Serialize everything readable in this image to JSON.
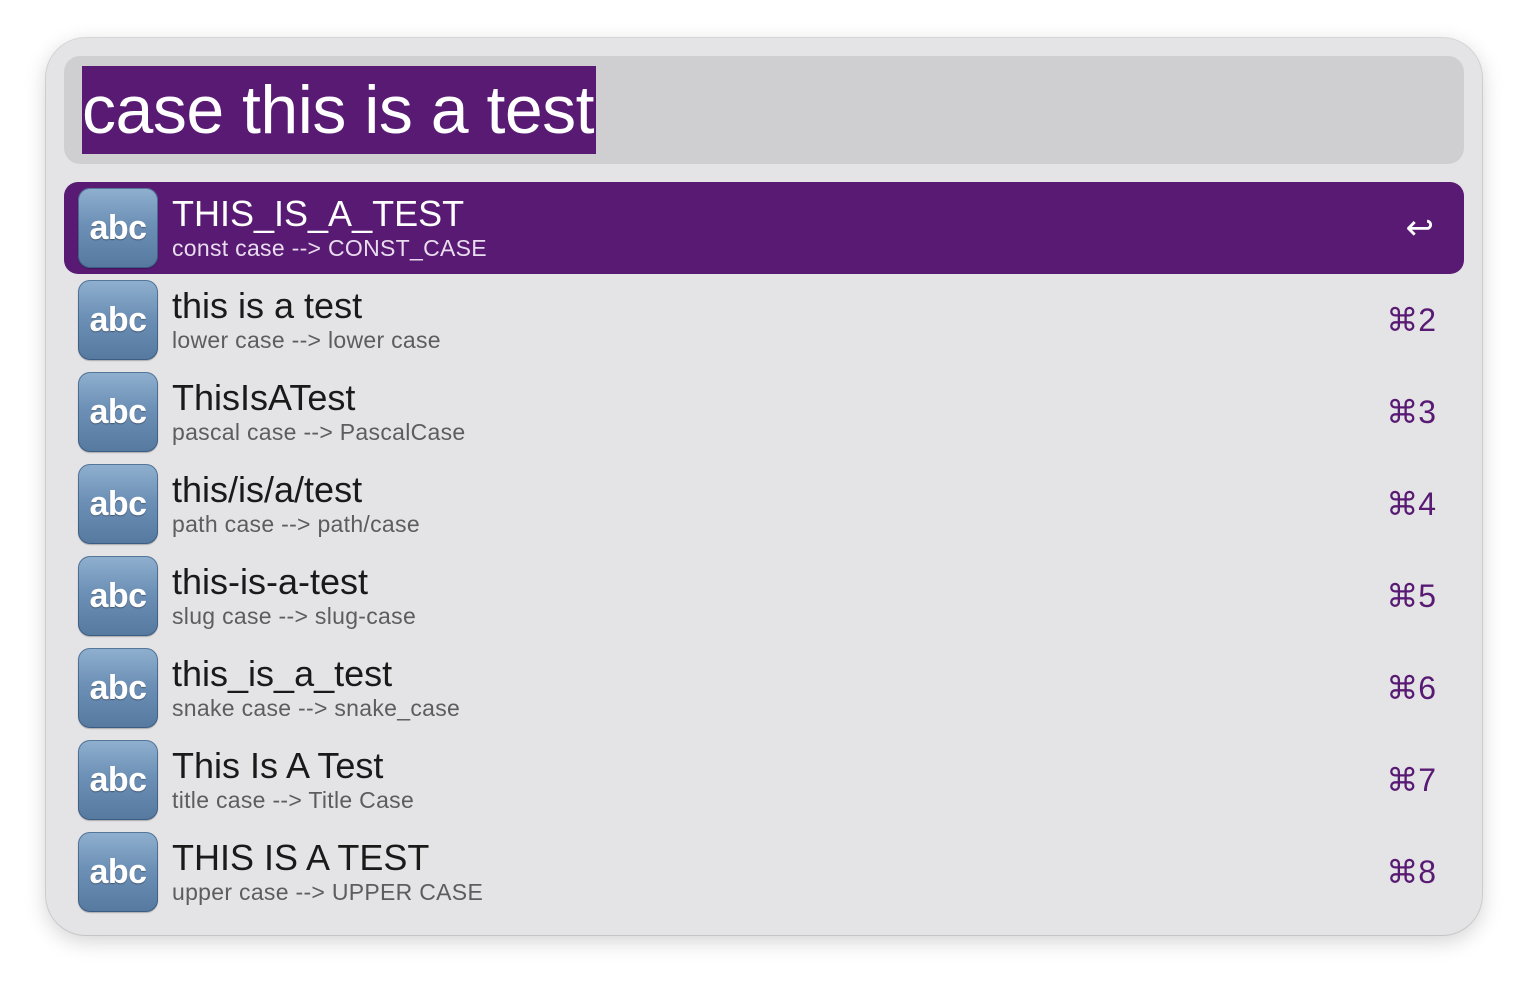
{
  "search": {
    "query": "case this is a test"
  },
  "colors": {
    "accent": "#581a73",
    "background": "#e4e4e6",
    "search_background": "#cfcfd1"
  },
  "results": [
    {
      "icon": "abc",
      "icon_name": "abc-text-icon",
      "title": "THIS_IS_A_TEST",
      "subtitle": "const case --> CONST_CASE",
      "shortcut": "↩",
      "selected": true
    },
    {
      "icon": "abc",
      "icon_name": "abc-text-icon",
      "title": "this is a test",
      "subtitle": "lower case --> lower case",
      "shortcut": "⌘2",
      "selected": false
    },
    {
      "icon": "abc",
      "icon_name": "abc-text-icon",
      "title": "ThisIsATest",
      "subtitle": "pascal case --> PascalCase",
      "shortcut": "⌘3",
      "selected": false
    },
    {
      "icon": "abc",
      "icon_name": "abc-text-icon",
      "title": "this/is/a/test",
      "subtitle": "path case --> path/case",
      "shortcut": "⌘4",
      "selected": false
    },
    {
      "icon": "abc",
      "icon_name": "abc-text-icon",
      "title": "this-is-a-test",
      "subtitle": "slug case --> slug-case",
      "shortcut": "⌘5",
      "selected": false
    },
    {
      "icon": "abc",
      "icon_name": "abc-text-icon",
      "title": "this_is_a_test",
      "subtitle": "snake case --> snake_case",
      "shortcut": "⌘6",
      "selected": false
    },
    {
      "icon": "abc",
      "icon_name": "abc-text-icon",
      "title": "This Is A Test",
      "subtitle": "title case --> Title Case",
      "shortcut": "⌘7",
      "selected": false
    },
    {
      "icon": "abc",
      "icon_name": "abc-text-icon",
      "title": "THIS IS A TEST",
      "subtitle": "upper case --> UPPER CASE",
      "shortcut": "⌘8",
      "selected": false
    }
  ]
}
